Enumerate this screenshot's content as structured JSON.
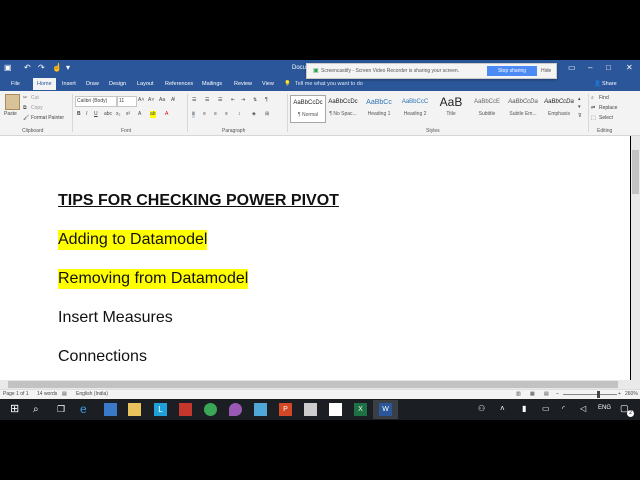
{
  "title_bar": {
    "doc_name": "Docu"
  },
  "notification": {
    "text": "Screencastify - Screen Video Recorder is sharing your screen.",
    "stop_label": "Stop sharing",
    "hide_label": "Hide"
  },
  "tabs": [
    "File",
    "Home",
    "Insert",
    "Draw",
    "Design",
    "Layout",
    "References",
    "Mailings",
    "Review",
    "View"
  ],
  "tell_me": "Tell me what you want to do",
  "share_label": "Share",
  "clipboard": {
    "paste": "Paste",
    "cut": "Cut",
    "copy": "Copy",
    "format_painter": "Format Painter",
    "group": "Clipboard"
  },
  "font": {
    "name": "Calibri (Body)",
    "size": "11",
    "group": "Font"
  },
  "paragraph": {
    "group": "Paragraph"
  },
  "styles": {
    "group": "Styles",
    "items": [
      {
        "preview": "AaBbCcDc",
        "name": "¶ Normal"
      },
      {
        "preview": "AaBbCcDc",
        "name": "¶ No Spac..."
      },
      {
        "preview": "AaBbCc",
        "name": "Heading 1"
      },
      {
        "preview": "AaBbCcC",
        "name": "Heading 2"
      },
      {
        "preview": "AaB",
        "name": "Title"
      },
      {
        "preview": "AaBbCcE",
        "name": "Subtitle"
      },
      {
        "preview": "AaBbCcDa",
        "name": "Subtle Em..."
      },
      {
        "preview": "AaBbCcDa",
        "name": "Emphasis"
      }
    ]
  },
  "editing": {
    "find": "Find",
    "replace": "Replace",
    "select": "Select",
    "group": "Editing"
  },
  "document": {
    "heading": "TIPS FOR CHECKING POWER PIVOT",
    "line1": "Adding to Datamodel",
    "line2": "Removing from Datamodel",
    "line3": "Insert Measures",
    "line4": "Connections"
  },
  "status": {
    "page": "Page 1 of 1",
    "words": "14 words",
    "language": "English (India)",
    "zoom": "260%"
  },
  "taskbar": {
    "lang": "ENG",
    "notif_count": "2"
  },
  "colors": {
    "word_blue": "#2b579a",
    "highlight": "#ffff00",
    "taskbar": "#1b1f24"
  }
}
